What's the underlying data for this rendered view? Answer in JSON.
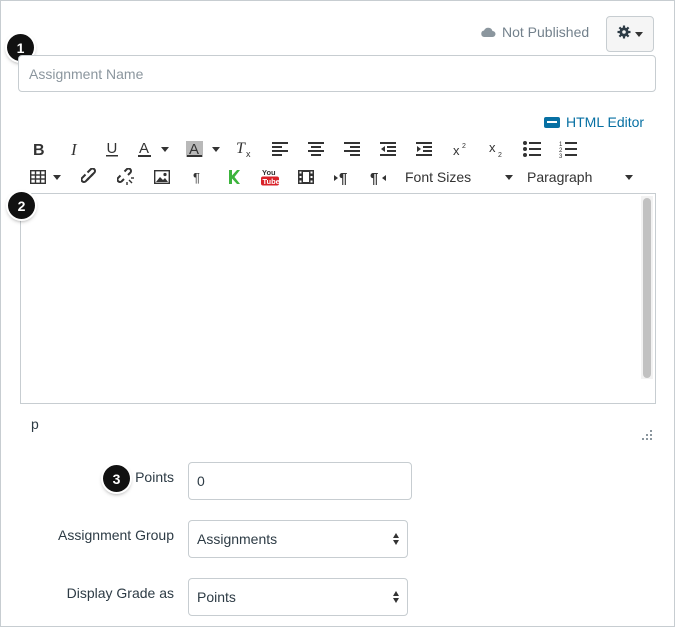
{
  "header": {
    "publish_status": "Not Published"
  },
  "assignment_name": {
    "placeholder": "Assignment Name",
    "value": ""
  },
  "editor": {
    "html_editor_link": "HTML Editor",
    "font_sizes_label": "Font Sizes",
    "paragraph_label": "Paragraph",
    "path_text": "p",
    "toolbar_row1": [
      "bold",
      "italic",
      "underline",
      "text-color",
      "background-color",
      "clear-formatting",
      "align-left",
      "align-center",
      "align-right",
      "outdent",
      "indent",
      "superscript",
      "subscript",
      "bullet-list",
      "numbered-list"
    ],
    "toolbar_row2": [
      "table",
      "link",
      "unlink",
      "image",
      "paragraph-mark",
      "kaltura",
      "youtube",
      "media",
      "ltr",
      "rtl"
    ]
  },
  "callouts": [
    "1",
    "2",
    "3"
  ],
  "form": {
    "points_label": "Points",
    "points_value": "0",
    "group_label": "Assignment Group",
    "group_value": "Assignments",
    "display_grade_label": "Display Grade as",
    "display_grade_value": "Points"
  },
  "colors": {
    "link": "#0770a3",
    "border": "#c7cdd1",
    "text": "#2d3b45"
  }
}
